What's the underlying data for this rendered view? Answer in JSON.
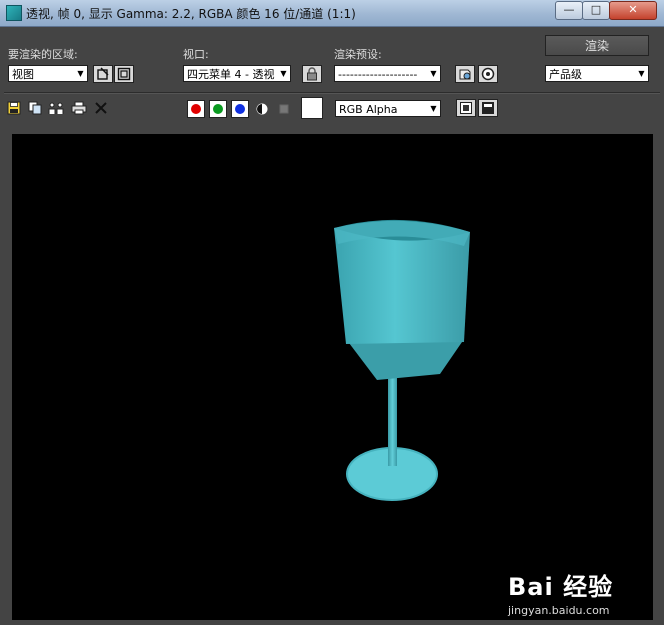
{
  "window": {
    "title": "透视, 帧 0, 显示 Gamma: 2.2, RGBA 颜色 16 位/通道 (1:1)",
    "min_label": "—",
    "max_label": "□",
    "close_label": "✕"
  },
  "toolbar": {
    "area_label": "要渲染的区域:",
    "area_value": "视图",
    "viewport_label": "视口:",
    "viewport_value": "四元菜单 4 - 透视",
    "preset_label": "渲染预设:",
    "preset_value": "--------------------",
    "render_button": "渲染",
    "quality_value": "产品级",
    "channel_value": "RGB Alpha"
  },
  "watermark": {
    "logo_text": "Bai 经验",
    "url_text": "jingyan.baidu.com"
  },
  "colors": {
    "red_channel": "#e00000",
    "green_channel": "#0a9a20",
    "blue_channel": "#1030e0",
    "goblet": "#4fc3cf"
  }
}
